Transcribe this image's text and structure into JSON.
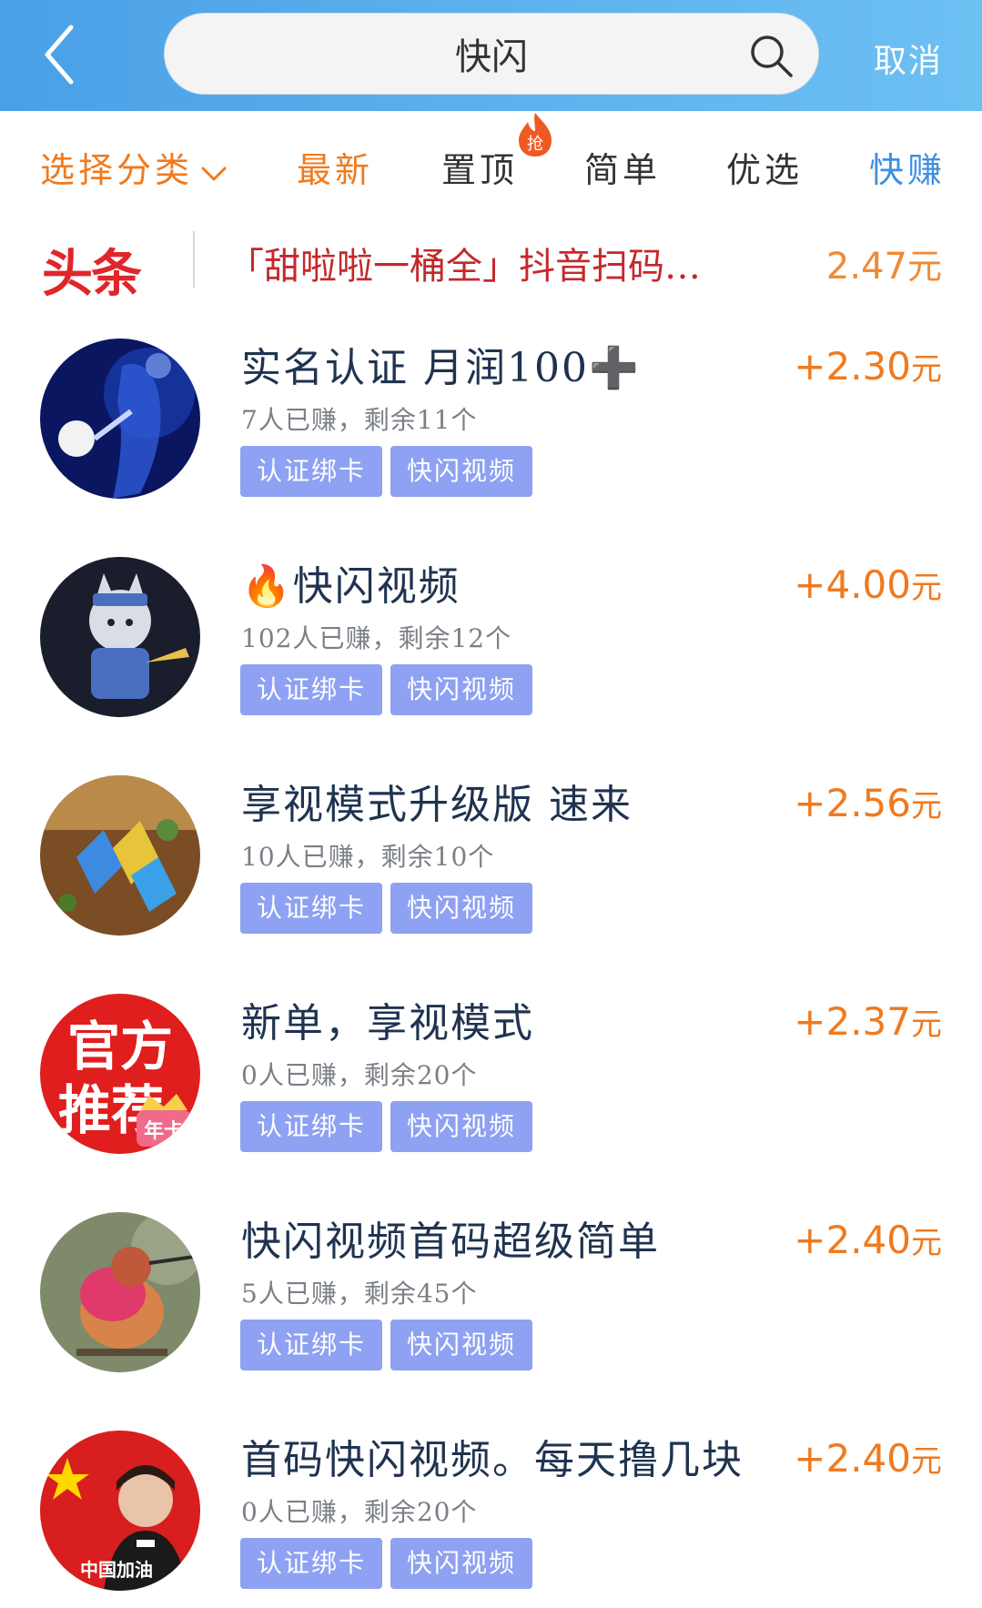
{
  "search": {
    "value": "快闪",
    "cancel_label": "取消"
  },
  "filters": {
    "category_label": "选择分类",
    "tabs": [
      "最新",
      "置顶",
      "简单",
      "优选",
      "快赚"
    ],
    "hot_badge": "抢"
  },
  "headline": {
    "logo": "头条",
    "text": "「甜啦啦一桶全」抖音扫码…",
    "price": "2.47",
    "unit": "元"
  },
  "tasks": [
    {
      "title": "实名认证 月润100➕",
      "earned": "7人已赚，剩余11个",
      "price": "+2.30",
      "unit": "元",
      "tags": [
        "认证绑卡",
        "快闪视频"
      ]
    },
    {
      "title": "🔥快闪视频",
      "earned": "102人已赚，剩余12个",
      "price": "+4.00",
      "unit": "元",
      "tags": [
        "认证绑卡",
        "快闪视频"
      ]
    },
    {
      "title": "享视模式升级版 速来",
      "earned": "10人已赚，剩余10个",
      "price": "+2.56",
      "unit": "元",
      "tags": [
        "认证绑卡",
        "快闪视频"
      ]
    },
    {
      "title": "新单，享视模式",
      "earned": "0人已赚，剩余20个",
      "price": "+2.37",
      "unit": "元",
      "tags": [
        "认证绑卡",
        "快闪视频"
      ],
      "avatar_text": [
        "官方",
        "推荐",
        "年卡"
      ]
    },
    {
      "title": "快闪视频首码超级简单",
      "earned": "5人已赚，剩余45个",
      "price": "+2.40",
      "unit": "元",
      "tags": [
        "认证绑卡",
        "快闪视频"
      ]
    },
    {
      "title": "首码快闪视频。每天撸几块",
      "earned": "0人已赚，剩余20个",
      "price": "+2.40",
      "unit": "元",
      "tags": [
        "认证绑卡",
        "快闪视频"
      ],
      "avatar_text": [
        "中国加油"
      ]
    }
  ],
  "colors": {
    "header": "#5fb4ee",
    "accent_orange": "#f07a1e",
    "tag_bg": "#8ea1f2",
    "headline_red": "#c4282c",
    "tab_blue": "#3f8fe0"
  }
}
